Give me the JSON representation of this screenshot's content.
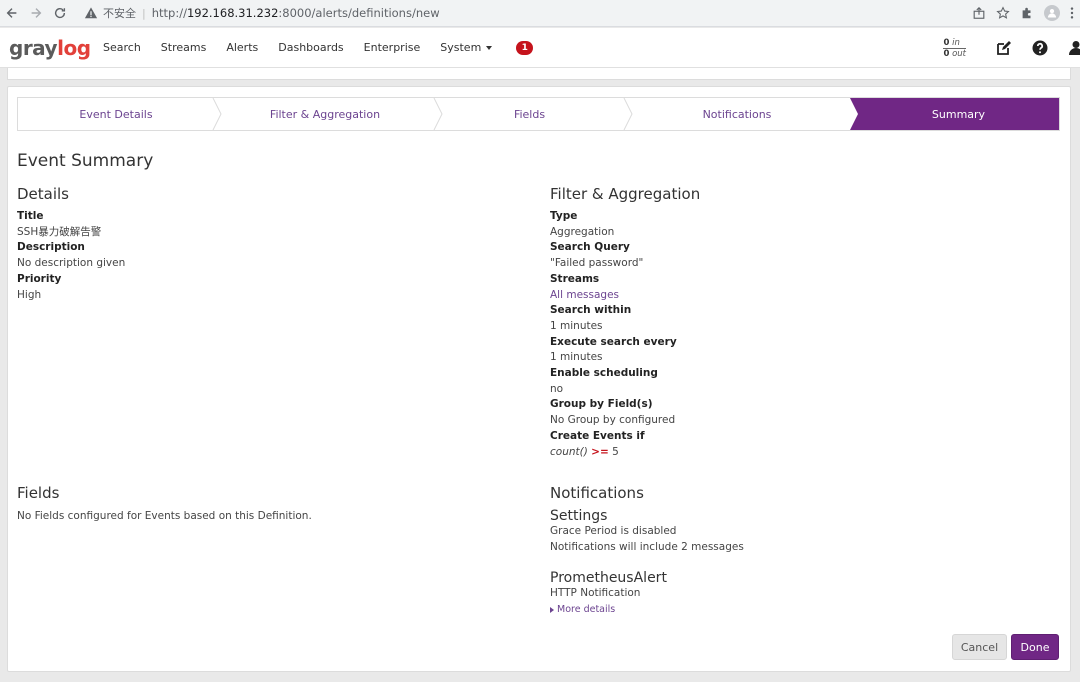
{
  "browser": {
    "insecure_label": "不安全",
    "url_scheme": "http://",
    "url_host": "192.168.31.232",
    "url_rest": ":8000/alerts/definitions/new"
  },
  "nav": {
    "logo_gray": "gray",
    "logo_log": "log",
    "items": [
      "Search",
      "Streams",
      "Alerts",
      "Dashboards",
      "Enterprise",
      "System"
    ],
    "notification_count": "1",
    "throughput_in": "0",
    "throughput_in_label": "in",
    "throughput_out": "0",
    "throughput_out_label": "out"
  },
  "wizard": {
    "steps": [
      "Event Details",
      "Filter & Aggregation",
      "Fields",
      "Notifications",
      "Summary"
    ],
    "active_step": "Summary",
    "accent_color": "#702785"
  },
  "summary": {
    "heading": "Event Summary",
    "details": {
      "heading": "Details",
      "title_label": "Title",
      "title_value": "SSH暴力破解告警",
      "description_label": "Description",
      "description_value": "No description given",
      "priority_label": "Priority",
      "priority_value": "High"
    },
    "filter": {
      "heading": "Filter & Aggregation",
      "type_label": "Type",
      "type_value": "Aggregation",
      "query_label": "Search Query",
      "query_value": "\"Failed password\"",
      "streams_label": "Streams",
      "streams_value": "All messages",
      "within_label": "Search within",
      "within_value": "1 minutes",
      "every_label": "Execute search every",
      "every_value": "1 minutes",
      "scheduling_label": "Enable scheduling",
      "scheduling_value": "no",
      "groupby_label": "Group by Field(s)",
      "groupby_value": "No Group by configured",
      "create_label": "Create Events if",
      "create_func": "count()",
      "create_op": ">=",
      "create_threshold": "5"
    },
    "fields": {
      "heading": "Fields",
      "text": "No Fields configured for Events based on this Definition."
    },
    "notifications": {
      "heading": "Notifications",
      "settings_heading": "Settings",
      "grace": "Grace Period is disabled",
      "include": "Notifications will include 2 messages",
      "notif_title": "PrometheusAlert",
      "notif_type": "HTTP Notification",
      "more_details": "More details"
    }
  },
  "buttons": {
    "cancel": "Cancel",
    "done": "Done"
  }
}
